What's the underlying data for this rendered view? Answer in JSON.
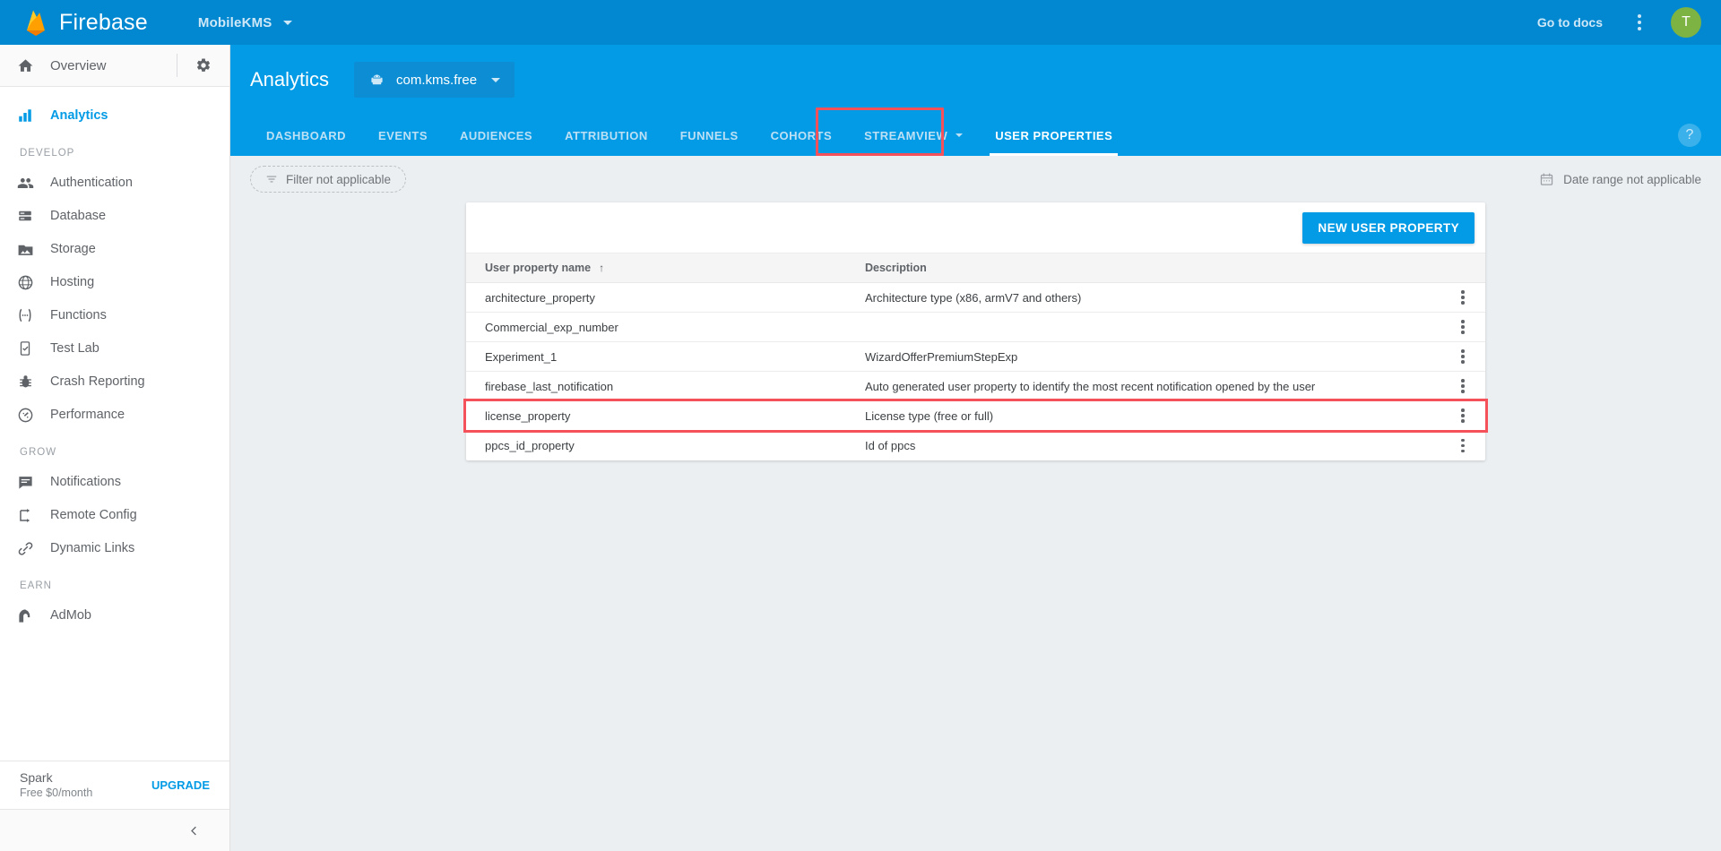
{
  "topbar": {
    "brand": "Firebase",
    "project_name": "MobileKMS",
    "go_to_docs": "Go to docs",
    "avatar_initial": "T"
  },
  "sidebar": {
    "overview": "Overview",
    "primary": [
      {
        "label": "Analytics",
        "icon": "bar-chart-icon",
        "active": true
      }
    ],
    "groups": [
      {
        "title": "DEVELOP",
        "items": [
          {
            "label": "Authentication",
            "icon": "people-icon"
          },
          {
            "label": "Database",
            "icon": "database-icon"
          },
          {
            "label": "Storage",
            "icon": "storage-icon"
          },
          {
            "label": "Hosting",
            "icon": "hosting-globe-icon"
          },
          {
            "label": "Functions",
            "icon": "functions-icon"
          },
          {
            "label": "Test Lab",
            "icon": "test-lab-icon"
          },
          {
            "label": "Crash Reporting",
            "icon": "bug-icon"
          },
          {
            "label": "Performance",
            "icon": "performance-gauge-icon"
          }
        ]
      },
      {
        "title": "GROW",
        "items": [
          {
            "label": "Notifications",
            "icon": "message-icon"
          },
          {
            "label": "Remote Config",
            "icon": "remote-config-icon"
          },
          {
            "label": "Dynamic Links",
            "icon": "link-icon"
          }
        ]
      },
      {
        "title": "EARN",
        "items": [
          {
            "label": "AdMob",
            "icon": "admob-icon"
          }
        ]
      }
    ],
    "plan": {
      "name": "Spark",
      "detail": "Free $0/month",
      "upgrade_label": "UPGRADE"
    }
  },
  "main": {
    "title": "Analytics",
    "app_chip": {
      "label": "com.kms.free",
      "icon": "android-icon"
    },
    "tabs": [
      {
        "label": "DASHBOARD",
        "active": false,
        "caret": false
      },
      {
        "label": "EVENTS",
        "active": false,
        "caret": false
      },
      {
        "label": "AUDIENCES",
        "active": false,
        "caret": false
      },
      {
        "label": "ATTRIBUTION",
        "active": false,
        "caret": false
      },
      {
        "label": "FUNNELS",
        "active": false,
        "caret": false
      },
      {
        "label": "COHORTS",
        "active": false,
        "caret": false
      },
      {
        "label": "STREAMVIEW",
        "active": false,
        "caret": true
      },
      {
        "label": "USER PROPERTIES",
        "active": true,
        "caret": false
      }
    ],
    "help_glyph": "?",
    "filter_label": "Filter not applicable",
    "date_range_label": "Date range not applicable"
  },
  "table": {
    "new_property_button": "NEW USER PROPERTY",
    "columns": [
      "User property name",
      "Description"
    ],
    "sort_indicator": "↑",
    "rows": [
      {
        "name": "architecture_property",
        "description": "Architecture type (x86, armV7 and others)",
        "highlighted": false
      },
      {
        "name": "Commercial_exp_number",
        "description": "",
        "highlighted": false
      },
      {
        "name": "Experiment_1",
        "description": "WizardOfferPremiumStepExp",
        "highlighted": false
      },
      {
        "name": "firebase_last_notification",
        "description": "Auto generated user property to identify the most recent notification opened by the user",
        "highlighted": false
      },
      {
        "name": "license_property",
        "description": "License type (free or full)",
        "highlighted": true
      },
      {
        "name": "ppcs_id_property",
        "description": "Id of ppcs",
        "highlighted": false
      }
    ]
  },
  "colors": {
    "brand_blue": "#039be5",
    "topbar_blue": "#0288d1",
    "highlight_red": "#f4515b",
    "avatar_green": "#7cb342",
    "page_bg": "#eceff1"
  }
}
